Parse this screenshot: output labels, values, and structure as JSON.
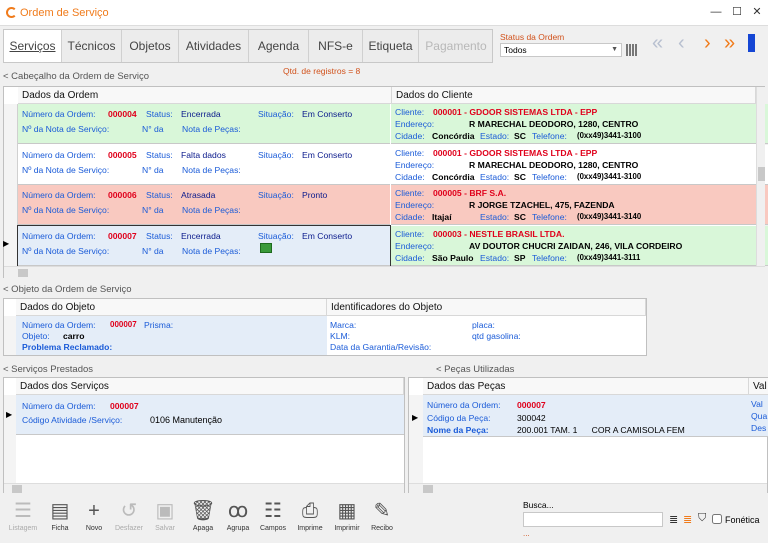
{
  "window": {
    "title": "Ordem de Serviço",
    "min": "—",
    "max": "☐",
    "close": "✕"
  },
  "tabs": [
    {
      "label": "Serviços",
      "active": true
    },
    {
      "label": "Técnicos"
    },
    {
      "label": "Objetos"
    },
    {
      "label": "Atividades"
    },
    {
      "label": "Agenda"
    },
    {
      "label": "NFS-e"
    },
    {
      "label": "Etiqueta"
    },
    {
      "label": "Pagamento",
      "disabled": true
    }
  ],
  "status_filter": {
    "label": "Status da Ordem",
    "value": "Todos"
  },
  "record_count": "Qtd. de registros = 8",
  "header_section": {
    "title": "< Cabeçalho da Ordem de Serviço",
    "col_order": "Dados da Ordem",
    "col_client": "Dados do Cliente"
  },
  "orders": [
    {
      "bg": "#d9f7d9",
      "num_label": "Número da Ordem:",
      "num": "000004",
      "status_label": "Status:",
      "status": "Encerrada",
      "sit_label": "Situação:",
      "sit": "Em Conserto",
      "nf_label": "Nº da Nota de Serviço:",
      "n_label": "N° da",
      "np_label": "Nota de Peças:",
      "cli_label": "Cliente:",
      "cli": "000001 -  GDOOR SISTEMAS LTDA - EPP",
      "end_label": "Endereço:",
      "end": "R MARECHAL DEODORO, 1280, CENTRO",
      "cid_label": "Cidade:",
      "cid": "Concórdia",
      "est_label": "Estado:",
      "est": "SC",
      "tel_label": "Telefone:",
      "tel": "(0xx49)3441-3100"
    },
    {
      "bg": "#ffffff",
      "num_label": "Número da Ordem:",
      "num": "000005",
      "status_label": "Status:",
      "status": "Falta dados",
      "sit_label": "Situação:",
      "sit": "Em Conserto",
      "nf_label": "Nº da Nota de Serviço:",
      "n_label": "N° da",
      "np_label": "Nota de Peças:",
      "cli_label": "Cliente:",
      "cli": "000001 -  GDOOR SISTEMAS LTDA - EPP",
      "end_label": "Endereço:",
      "end": "R MARECHAL DEODORO, 1280, CENTRO",
      "cid_label": "Cidade:",
      "cid": "Concórdia",
      "est_label": "Estado:",
      "est": "SC",
      "tel_label": "Telefone:",
      "tel": "(0xx49)3441-3100"
    },
    {
      "bg": "#f9c9c0",
      "num_label": "Número da Ordem:",
      "num": "000006",
      "status_label": "Status:",
      "status": "Atrasada",
      "sit_label": "Situação:",
      "sit": "Pronto",
      "nf_label": "Nº da Nota de Serviço:",
      "n_label": "N° da",
      "np_label": "Nota de Peças:",
      "cli_label": "Cliente:",
      "cli": "000005 -  BRF S.A.",
      "end_label": "Endereço:",
      "end": "R JORGE TZACHEL, 475, FAZENDA",
      "cid_label": "Cidade:",
      "cid": "Itajaí",
      "est_label": "Estado:",
      "est": "SC",
      "tel_label": "Telefone:",
      "tel": "(0xx49)3441-3140"
    },
    {
      "bg": "#d9f7d9",
      "left_bg": "#e4edf8",
      "current": true,
      "num_label": "Número da Ordem:",
      "num": "000007",
      "status_label": "Status:",
      "status": "Encerrada",
      "sit_label": "Situação:",
      "sit": "Em Conserto",
      "nf_label": "Nº da Nota de Serviço:",
      "n_label": "N° da",
      "np_label": "Nota de Peças:",
      "cli_label": "Cliente:",
      "cli": "000003 -  NESTLE BRASIL LTDA.",
      "end_label": "Endereço:",
      "end": "AV DOUTOR CHUCRI ZAIDAN, 246, VILA CORDEIRO",
      "cid_label": "Cidade:",
      "cid": "São Paulo",
      "est_label": "Estado:",
      "est": "SP",
      "tel_label": "Telefone:",
      "tel": "(0xx49)3441-3111"
    }
  ],
  "object_section": {
    "title": "< Objeto da Ordem de Serviço",
    "col_data": "Dados do Objeto",
    "col_ids": "Identificadores do Objeto",
    "num_label": "Número da Ordem:",
    "num": "000007",
    "prisma_label": "Prisma:",
    "obj_label": "Objeto:",
    "obj": "carro",
    "prob_label": "Problema Reclamado:",
    "marca_label": "Marca:",
    "placa_label": "placa:",
    "klm_label": "KLM:",
    "gas_label": "qtd gasolina:",
    "garantia_label": "Data da Garantia/Revisão:"
  },
  "services_section": {
    "title": "< Serviços Prestados",
    "col": "Dados dos Serviços",
    "num_label": "Número da Ordem:",
    "num": "000007",
    "cod_label": "Código Atividade /Serviço:",
    "cod": "0106 Manutenção"
  },
  "parts_section": {
    "title": "< Peças Utilizadas",
    "col": "Dados das Peças",
    "col2": "Val",
    "num_label": "Número da Ordem:",
    "num": "000007",
    "cod_label": "Código da Peça:",
    "cod": "300042",
    "nome_label": "Nome da Peça:",
    "nome": "200.001 TAM. 1      COR A CAMISOLA FEM",
    "side": [
      "Val",
      "Qua",
      "Des"
    ]
  },
  "toolbar": [
    {
      "label": "Listagem",
      "icon": "☰",
      "disabled": true
    },
    {
      "label": "Ficha",
      "icon": "▤"
    },
    {
      "label": "Novo",
      "icon": "+"
    },
    {
      "label": "Desfazer",
      "icon": "↺",
      "disabled": true
    },
    {
      "label": "Salvar",
      "icon": "▣",
      "disabled": true
    },
    {
      "label": "Apaga",
      "icon": "🗑"
    },
    {
      "label": "Agrupa",
      "icon": "ꝏ"
    },
    {
      "label": "Campos",
      "icon": "☷"
    },
    {
      "label": "Imprime",
      "icon": "⎙"
    },
    {
      "label": "Imprimir",
      "icon": "▦"
    },
    {
      "label": "Recibo",
      "icon": "✎"
    }
  ],
  "search": {
    "label": "Busca...",
    "placeholder": "",
    "phonetic_label": "Fonética",
    "dots": "..."
  },
  "colors": {
    "accent": "#f07b1b",
    "label_blue": "#1a5bd8",
    "value_red": "#e0001b",
    "navy": "#0a1a8c"
  }
}
